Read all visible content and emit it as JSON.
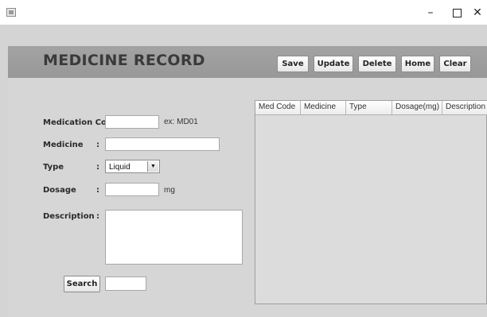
{
  "window": {
    "icon": "java-app-icon",
    "minimize_glyph": "–",
    "close_glyph": "✕"
  },
  "header": {
    "title": "MEDICINE RECORD",
    "buttons": {
      "save": "Save",
      "update": "Update",
      "delete": "Delete",
      "home": "Home",
      "clear": "Clear"
    }
  },
  "form": {
    "medication_code": {
      "label": "Medication Code :",
      "value": "",
      "hint": "ex: MD01"
    },
    "medicine": {
      "label": "Medicine",
      "colon": ":",
      "value": ""
    },
    "type": {
      "label": "Type",
      "colon": ":",
      "selected": "Liquid",
      "arrow": "▼"
    },
    "dosage": {
      "label": "Dosage",
      "colon": ":",
      "value": "",
      "unit": "mg"
    },
    "description": {
      "label": "Description",
      "colon": ":",
      "value": ""
    },
    "search": {
      "button": "Search",
      "value": ""
    }
  },
  "table": {
    "columns": [
      "Med Code",
      "Medicine",
      "Type",
      "Dosage(mg)",
      "Description"
    ],
    "rows": []
  },
  "colors": {
    "background": "#d4d4d4",
    "header_band": "#9e9e9e",
    "title_text": "#3a3a3a"
  }
}
